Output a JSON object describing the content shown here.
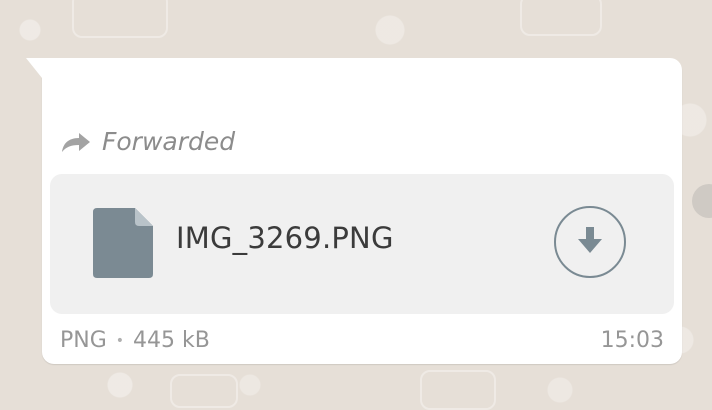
{
  "chat": {
    "message": {
      "forwarded_label": "Forwarded",
      "file_name": "IMG_3269.PNG",
      "file_type": "PNG",
      "separator": "•",
      "file_size": "445 kB",
      "timestamp": "15:03"
    },
    "icons": {
      "forward": "forward-arrow-icon",
      "file": "document-icon",
      "download": "download-arrow-icon"
    },
    "colors": {
      "bubble": "#ffffff",
      "file_card": "#f0f0f0",
      "file_icon": "#7b8a93",
      "meta_text": "#969696",
      "wallpaper": "#e6dfd7"
    }
  }
}
